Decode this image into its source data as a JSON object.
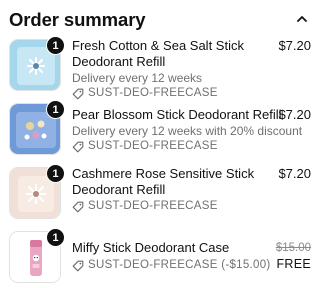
{
  "header": {
    "title": "Order summary",
    "toggle_icon": "chevron-up-icon"
  },
  "items": [
    {
      "quantity": "1",
      "name_line1": "Fresh Cotton & Sea Salt Stick",
      "name_line2": "Deodorant Refill",
      "subtitle": "Delivery every 12 weeks",
      "discount_code": "SUST-DEO-FREECASE",
      "price": "$7.20",
      "thumb_color": "#9fd3ea"
    },
    {
      "quantity": "1",
      "name_line1": "Pear Blossom Stick Deodorant Refill",
      "subtitle": "Delivery every 12 weeks with 20% discount",
      "discount_code": "SUST-DEO-FREECASE",
      "price": "$7.20",
      "thumb_color": "#6e98d8"
    },
    {
      "quantity": "1",
      "name_line1": "Cashmere Rose Sensitive Stick",
      "name_line2": "Deodorant Refill",
      "discount_code": "SUST-DEO-FREECASE",
      "price": "$7.20",
      "thumb_color": "#f0ddd3"
    },
    {
      "quantity": "1",
      "name_line1": "Miffy Stick Deodorant Case",
      "discount_code": "SUST-DEO-FREECASE (-$15.00)",
      "original_price": "$15.00",
      "price": "FREE",
      "thumb_color": "#ffffff"
    }
  ]
}
